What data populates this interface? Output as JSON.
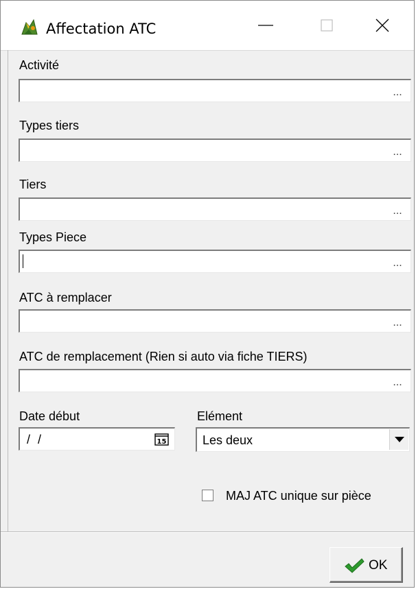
{
  "window": {
    "title": "Affectation ATC"
  },
  "fields": [
    {
      "label": "Activité",
      "value": "",
      "ellipsis": "..."
    },
    {
      "label": "Types tiers",
      "value": "",
      "ellipsis": "..."
    },
    {
      "label": "Tiers",
      "value": "",
      "ellipsis": "..."
    },
    {
      "label": "Types Piece",
      "value": "",
      "ellipsis": "..."
    },
    {
      "label": "ATC à remplacer",
      "value": "",
      "ellipsis": "..."
    },
    {
      "label": "ATC de remplacement (Rien si auto via fiche TIERS)",
      "value": "",
      "ellipsis": "..."
    }
  ],
  "date_debut": {
    "label": "Date début",
    "value": "/ /",
    "calendar_icon_text": "15"
  },
  "element": {
    "label": "Elément",
    "selected": "Les deux"
  },
  "checkbox": {
    "label": "MAJ ATC unique sur pièce",
    "checked": false
  },
  "ok_button": {
    "label": "OK"
  },
  "icons": {
    "app": "app-icon",
    "minimize": "minimize-icon",
    "maximize": "maximize-icon",
    "close": "close-icon",
    "calendar": "calendar-icon",
    "dropdown": "chevron-down-icon",
    "ok": "checkmark-icon"
  },
  "colors": {
    "window_bg": "#f0f0f0",
    "titlebar_bg": "#ffffff",
    "checkmark": "#2e9a2e"
  }
}
